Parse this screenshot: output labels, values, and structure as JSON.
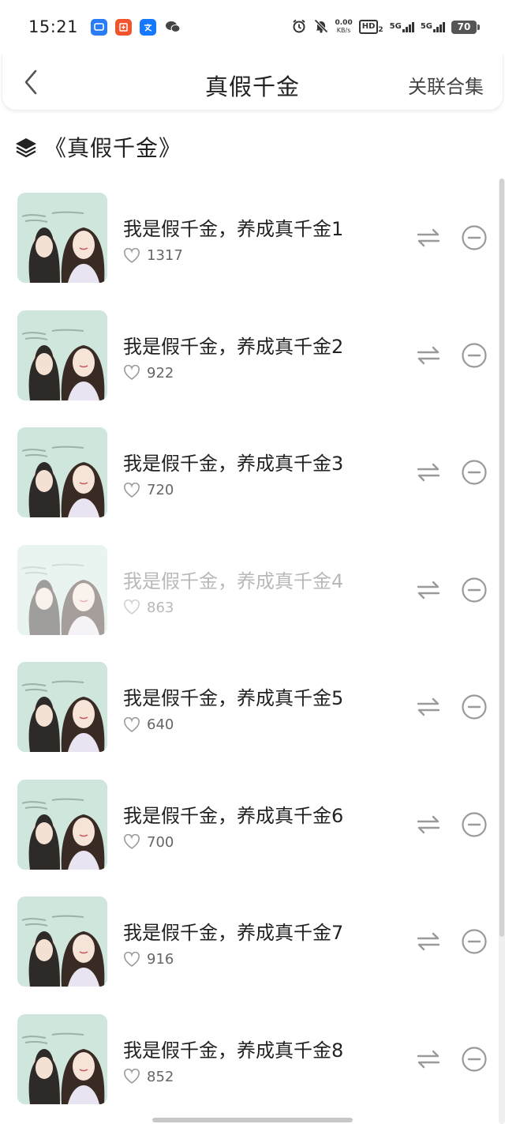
{
  "status_bar": {
    "time": "15:21",
    "net_speed_value": "0.00",
    "net_speed_unit": "KB/s",
    "hd_label": "HD",
    "hd_sub": "2",
    "sim1_net": "5G",
    "sim2_net": "5G",
    "battery": "70"
  },
  "header": {
    "title": "真假千金",
    "action_label": "关联合集"
  },
  "collection": {
    "title": "《真假千金》"
  },
  "colors": {
    "thumb_bg": "#cfe6dc",
    "icon_gray": "#9a9a9a"
  },
  "items": [
    {
      "title": "我是假千金，养成真千金1",
      "likes": "1317"
    },
    {
      "title": "我是假千金，养成真千金2",
      "likes": "922"
    },
    {
      "title": "我是假千金，养成真千金3",
      "likes": "720"
    },
    {
      "title": "我是假千金，养成真千金4",
      "likes": "863"
    },
    {
      "title": "我是假千金，养成真千金5",
      "likes": "640"
    },
    {
      "title": "我是假千金，养成真千金6",
      "likes": "700"
    },
    {
      "title": "我是假千金，养成真千金7",
      "likes": "916"
    },
    {
      "title": "我是假千金，养成真千金8",
      "likes": "852"
    }
  ]
}
